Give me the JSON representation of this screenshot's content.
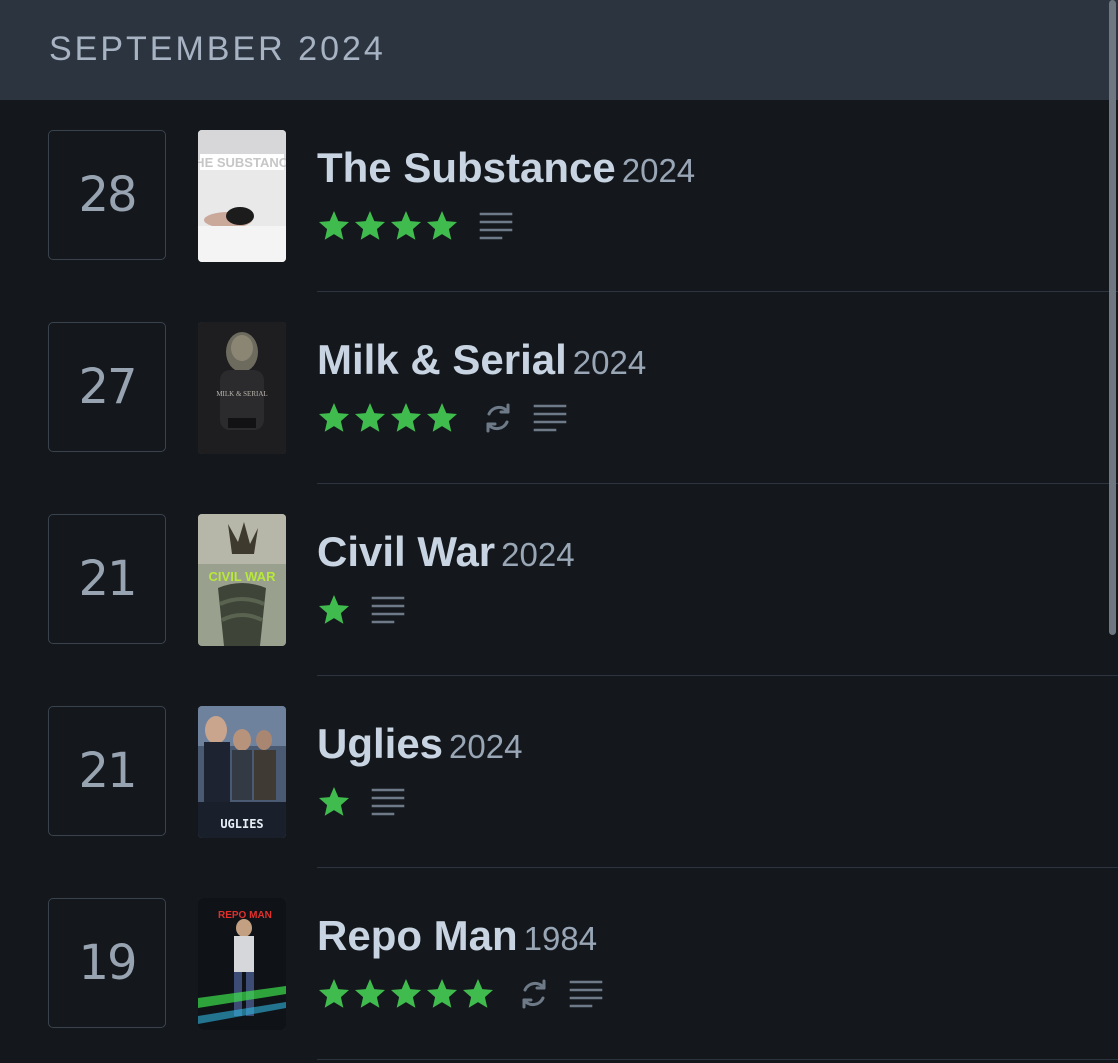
{
  "header": {
    "month": "SEPTEMBER 2024"
  },
  "colors": {
    "star": "#40bc4e",
    "muted_icon": "#6e7a88"
  },
  "entries": [
    {
      "day": "28",
      "title": "The Substance",
      "year": "2024",
      "rating": 4,
      "rewatch": false,
      "review": true,
      "poster": {
        "icon": "the-substance-poster",
        "caption": "THE SUBSTANCE"
      }
    },
    {
      "day": "27",
      "title": "Milk & Serial",
      "year": "2024",
      "rating": 4,
      "rewatch": true,
      "review": true,
      "poster": {
        "icon": "milk-and-serial-poster",
        "caption": "MILK & SERIAL"
      }
    },
    {
      "day": "21",
      "title": "Civil War",
      "year": "2024",
      "rating": 1,
      "rewatch": false,
      "review": true,
      "poster": {
        "icon": "civil-war-poster",
        "caption": "CIVIL WAR"
      }
    },
    {
      "day": "21",
      "title": "Uglies",
      "year": "2024",
      "rating": 1,
      "rewatch": false,
      "review": true,
      "poster": {
        "icon": "uglies-poster",
        "caption": "UGLIES"
      }
    },
    {
      "day": "19",
      "title": "Repo Man",
      "year": "1984",
      "rating": 5,
      "rewatch": true,
      "review": true,
      "poster": {
        "icon": "repo-man-poster",
        "caption": "REPO MAN"
      }
    }
  ]
}
